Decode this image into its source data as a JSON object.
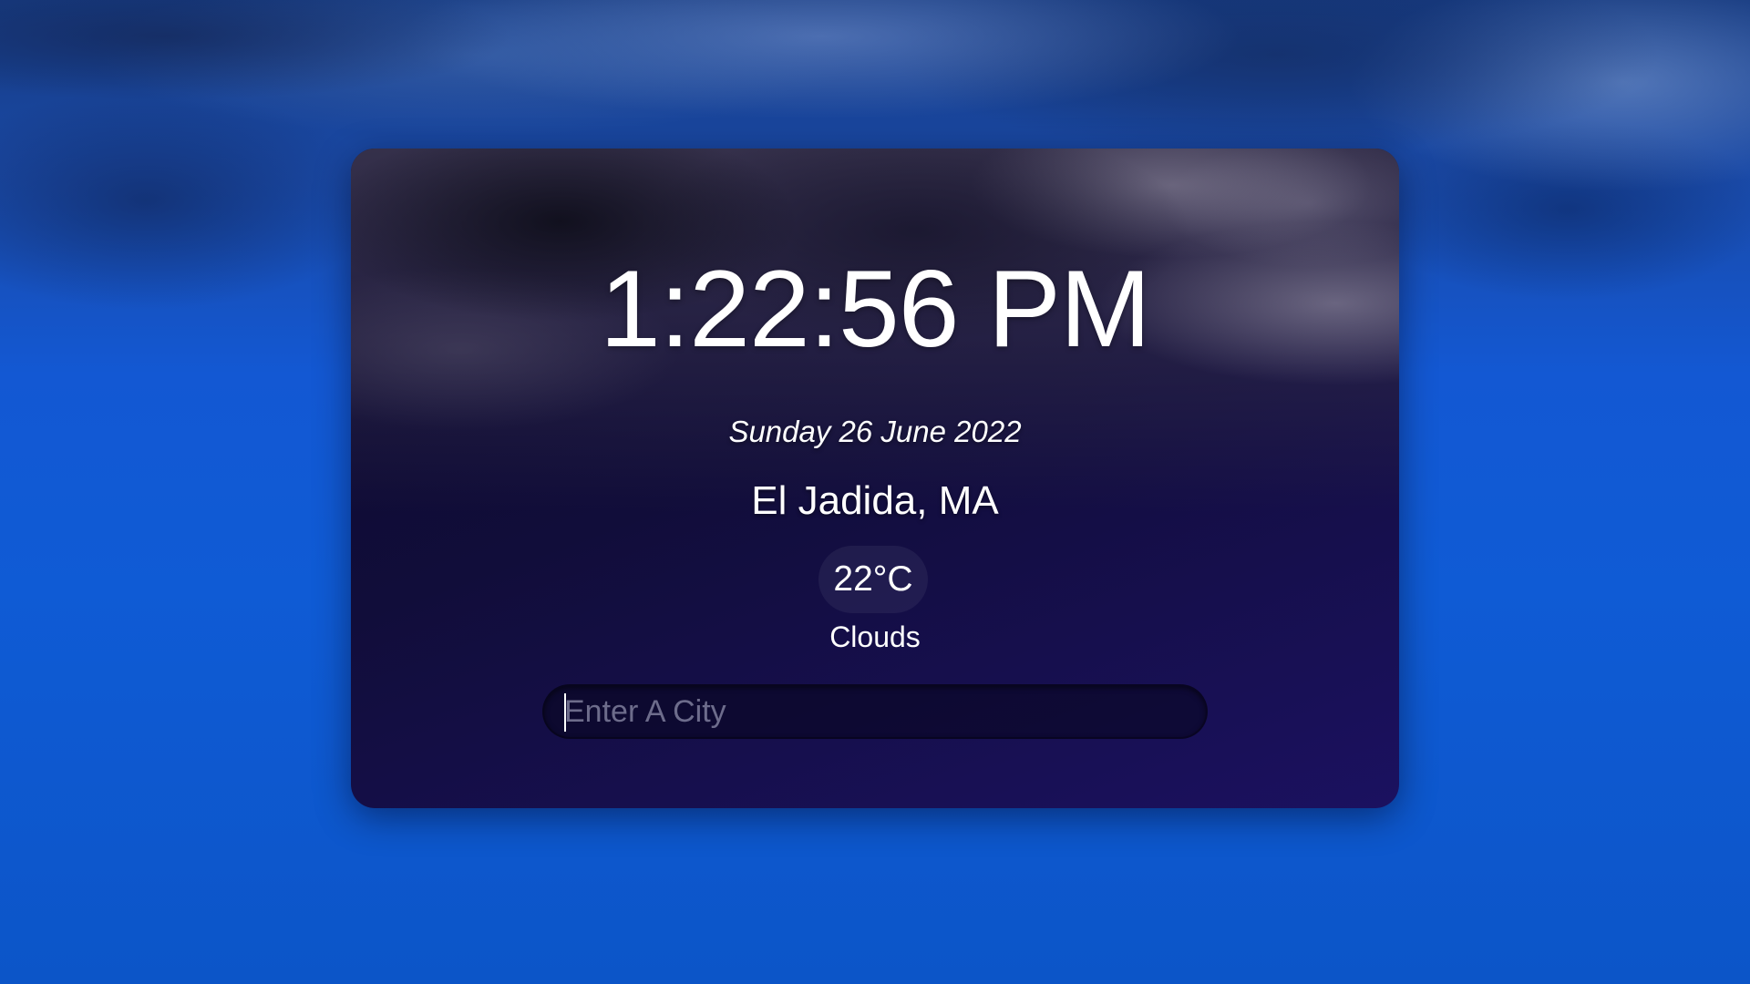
{
  "clock": {
    "time": "1:22:56 PM"
  },
  "date": {
    "text": "Sunday 26 June 2022"
  },
  "location": {
    "text": "El Jadida, MA"
  },
  "weather": {
    "temperature": "22°C",
    "condition": "Clouds"
  },
  "search": {
    "placeholder": "Enter A City",
    "value": ""
  },
  "colors": {
    "page_background": "#0f5bd5",
    "card_background": "#110d3a",
    "text": "#ffffff"
  }
}
